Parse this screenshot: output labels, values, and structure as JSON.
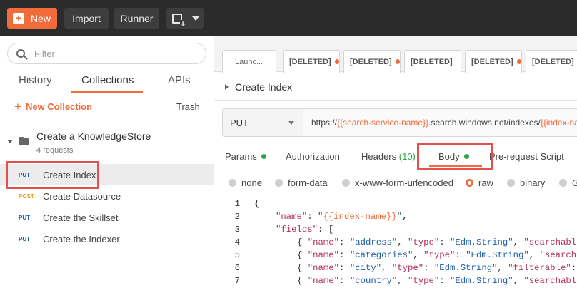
{
  "topbar": {
    "new_label": "New",
    "import_label": "Import",
    "runner_label": "Runner",
    "new_window_icon": "new-window-plus-icon"
  },
  "sidebar": {
    "filter_placeholder": "Filter",
    "tabs": [
      "History",
      "Collections",
      "APIs"
    ],
    "active_tab": "Collections",
    "new_collection_label": "New Collection",
    "trash_label": "Trash",
    "collection": {
      "name": "Create a KnowledgeStore",
      "count": "4 requests",
      "requests": [
        {
          "method": "PUT",
          "name": "Create Index",
          "selected": true
        },
        {
          "method": "POST",
          "name": "Create Datasource",
          "selected": false
        },
        {
          "method": "PUT",
          "name": "Create the Skillset",
          "selected": false
        },
        {
          "method": "PUT",
          "name": "Create the Indexer",
          "selected": false
        }
      ]
    }
  },
  "main": {
    "request_tabs": [
      {
        "label": "Launc...",
        "modified": false
      },
      {
        "label": "[DELETED]",
        "modified": true
      },
      {
        "label": "[DELETED]",
        "modified": true
      },
      {
        "label": "[DELETED]",
        "modified": false
      },
      {
        "label": "[DELETED]",
        "modified": true
      },
      {
        "label": "[DELETED]",
        "modified": true
      }
    ],
    "request_name": "Create Index",
    "method": "PUT",
    "url_prefix": "https://",
    "url_var1": "{{search-service-name}}",
    "url_mid": ".search.windows.net/indexes/",
    "url_var2": "{{index-name}}",
    "tabs": {
      "params": "Params",
      "authorization": "Authorization",
      "headers": "Headers",
      "headers_count": "(10)",
      "body": "Body",
      "prerequest": "Pre-request Script"
    },
    "body_options": [
      "none",
      "form-data",
      "x-www-form-urlencoded",
      "raw",
      "binary",
      "G"
    ],
    "body_selected": "raw",
    "code_lines": {
      "l1": "{",
      "l2_key": "\"name\"",
      "l2_val": "\"{{index-name}}\"",
      "l3_key": "\"fields\"",
      "l3_rest": ": [",
      "l4": [
        "\"name\"",
        "\"address\"",
        "\"type\"",
        "\"Edm.String\"",
        "\"searchable\""
      ],
      "l5": [
        "\"name\"",
        "\"categories\"",
        "\"type\"",
        "\"Edm.String\"",
        "\"searchab"
      ],
      "l6": [
        "\"name\"",
        "\"city\"",
        "\"type\"",
        "\"Edm.String\"",
        "\"filterable\"",
        ": t"
      ],
      "l7": [
        "\"name\"",
        "\"country\"",
        "\"type\"",
        "\"Edm.String\"",
        "\"searchable\""
      ]
    },
    "line_numbers": [
      "1",
      "2",
      "3",
      "4",
      "5",
      "6",
      "7"
    ]
  },
  "colors": {
    "accent": "#f26b3a",
    "topbar": "#2b2b2b",
    "highlight_box": "#e4504b",
    "put": "#1f5ea8",
    "post": "#e8a317",
    "ok": "#2fa34a"
  }
}
